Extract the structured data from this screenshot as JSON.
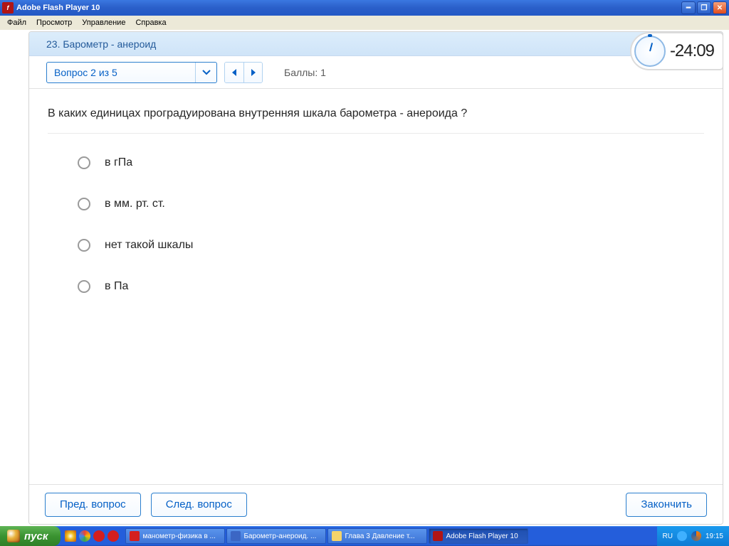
{
  "window": {
    "title": "Adobe Flash Player 10"
  },
  "menubar": [
    "Файл",
    "Просмотр",
    "Управление",
    "Справка"
  ],
  "header": {
    "title": "23. Барометр - анероид"
  },
  "toolbar": {
    "dropdown_label": "Вопрос 2 из 5",
    "points_text": "Баллы: 1"
  },
  "timer": "-24:09",
  "question": "В каких единицах проградуирована внутренняя шкала барометра - анероида ?",
  "options": [
    "в гПа",
    "в мм. рт. ст.",
    "нет такой шкалы",
    "в Па"
  ],
  "footer": {
    "prev": "Пред. вопрос",
    "next": "След. вопрос",
    "finish": "Закончить"
  },
  "taskbar": {
    "start": "пуск",
    "tasks": [
      "манометр-физика в ...",
      "Барометр-анероид. ...",
      "Глава 3 Давление т...",
      "Adobe Flash Player 10"
    ],
    "lang": "RU",
    "clock": "19:15"
  }
}
